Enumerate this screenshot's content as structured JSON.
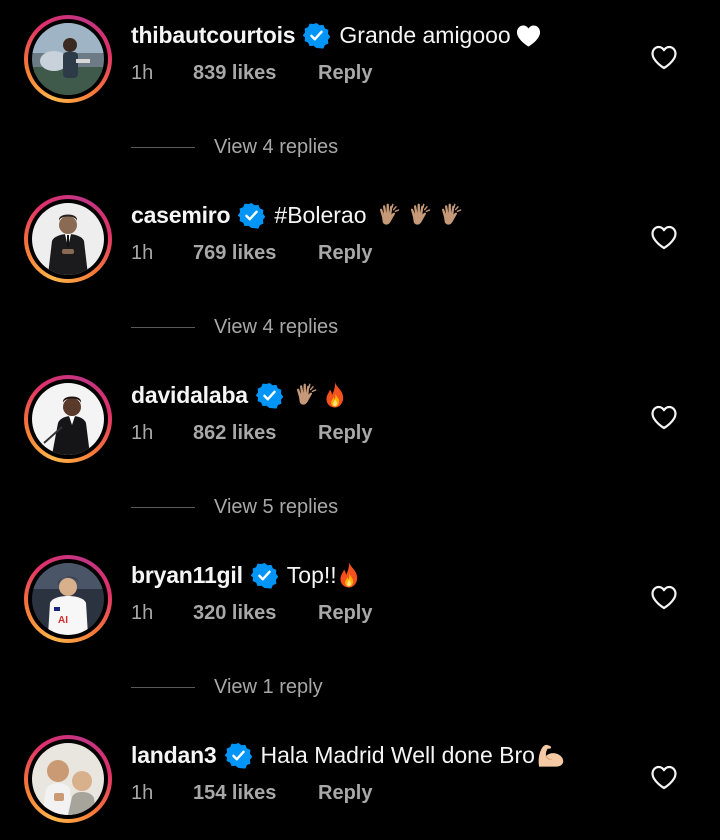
{
  "comments": [
    {
      "username": "thibautcourtois",
      "text": "Grande amigooo",
      "emoji_name": "white-heart-icon",
      "time": "1h",
      "likes": "839 likes",
      "reply": "Reply",
      "view_replies": "View 4 replies"
    },
    {
      "username": "casemiro",
      "text": "#Bolerao",
      "emoji_name": "clapping-hands-icon",
      "time": "1h",
      "likes": "769 likes",
      "reply": "Reply",
      "view_replies": "View 4 replies"
    },
    {
      "username": "davidalaba",
      "text": "",
      "emoji_name": "clapping-hands-fire-icon",
      "time": "1h",
      "likes": "862 likes",
      "reply": "Reply",
      "view_replies": "View 5 replies"
    },
    {
      "username": "bryan11gil",
      "text": "Top!!",
      "emoji_name": "fire-icon",
      "time": "1h",
      "likes": "320 likes",
      "reply": "Reply",
      "view_replies": "View 1 reply"
    },
    {
      "username": "landan3",
      "text": "Hala Madrid Well done Bro",
      "emoji_name": "flexed-biceps-icon",
      "time": "1h",
      "likes": "154 likes",
      "reply": "Reply"
    }
  ],
  "colors": {
    "background": "#000000",
    "primary_text": "#f5f5f5",
    "secondary_text": "#a8a8a8",
    "verified_blue": "#0095f6",
    "story_ring": [
      "#fdb54a",
      "#f77737",
      "#e1306c",
      "#c13584"
    ]
  }
}
